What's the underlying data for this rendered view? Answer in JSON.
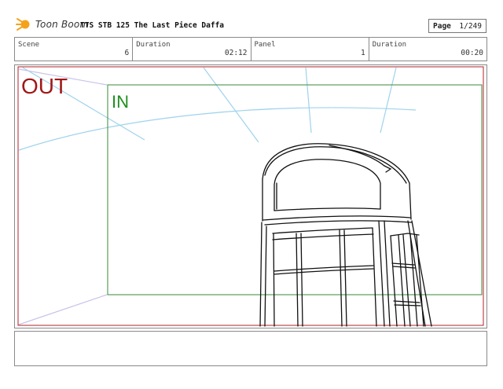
{
  "header": {
    "logo_text": "Toon Boom",
    "doc_title": "TTS STB 125 The Last Piece Daffa",
    "page_label": "Page",
    "page_value": "1/249"
  },
  "info": {
    "scene_label": "Scene",
    "scene_value": "6",
    "scene_duration_label": "Duration",
    "scene_duration_value": "02:12",
    "panel_label": "Panel",
    "panel_value": "1",
    "panel_duration_label": "Duration",
    "panel_duration_value": "00:20"
  },
  "panel": {
    "out_label": "OUT",
    "in_label": "IN",
    "colors": {
      "out_frame": "#b0202a",
      "in_frame": "#3a8a3a",
      "out_text": "#a01818",
      "in_text": "#1f8f1f",
      "guide_lines": "#9ed3ec",
      "sketch": "#111111"
    }
  },
  "notes": {
    "text": ""
  }
}
